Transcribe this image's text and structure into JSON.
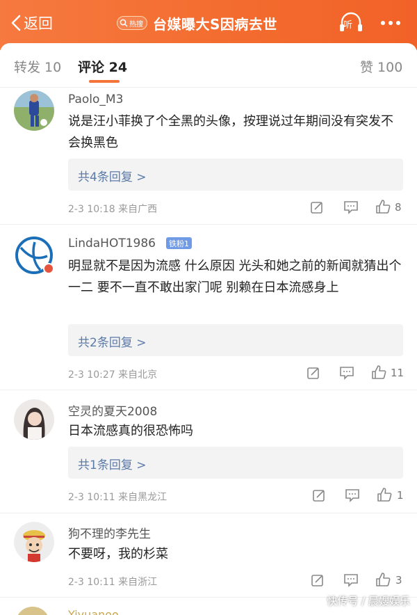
{
  "header": {
    "back_label": "返回",
    "hot_badge": "热搜",
    "title": "台媒曝大S因病去世",
    "listen_label": "听"
  },
  "tabs": [
    {
      "label": "转发 10"
    },
    {
      "label": "评论 24"
    },
    {
      "label": "赞 100"
    }
  ],
  "comments": [
    {
      "user": "Paolo_M3",
      "text": "说是汪小菲换了个全黑的头像，按理说过年期间没有突发不会换黑色",
      "replies": "共4条回复 >",
      "meta": "2-3 10:18  来自广西",
      "likes": "8"
    },
    {
      "user": "LindaHOT1986",
      "fan_badge": "铁粉1",
      "text": "明显就不是因为流感 什么原因 光头和她之前的新闻就猜出个一二 要不一直不敢出家门呢 别赖在日本流感身上",
      "replies": "共2条回复 >",
      "meta": "2-3 10:27  来自北京",
      "likes": "11"
    },
    {
      "user": "空灵的夏天2008",
      "text": "日本流感真的很恐怖吗",
      "replies": "共1条回复 >",
      "meta": "2-3 10:11  来自黑龙江",
      "likes": "1"
    },
    {
      "user": "狗不理的李先生",
      "text": "不要呀，我的杉菜",
      "meta": "2-3 10:11  来自浙江",
      "likes": "3"
    }
  ],
  "peek_user": "Yiyuanoo",
  "watermark": "快传号 / 晨嫂娱乐",
  "colors": {
    "accent": "#f36b2e",
    "link": "#5b7aa8",
    "underline": "#f5743a"
  }
}
